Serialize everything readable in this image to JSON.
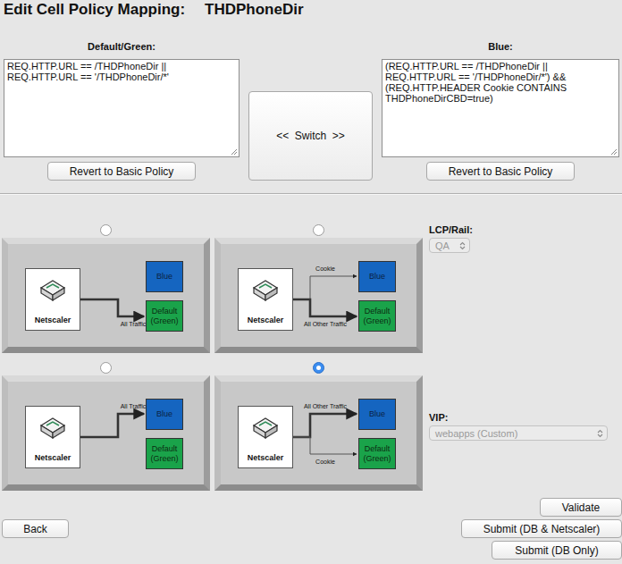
{
  "title": {
    "label": "Edit Cell Policy Mapping:",
    "name": "THDPhoneDir"
  },
  "policies": [
    {
      "label": "Default/Green:",
      "text": "REQ.HTTP.URL == /THDPhoneDir ||\nREQ.HTTP.URL == '/THDPhoneDir/*'",
      "revert": "Revert to Basic Policy"
    },
    {
      "label": "Blue:",
      "text": "(REQ.HTTP.URL == /THDPhoneDir ||\nREQ.HTTP.URL == '/THDPhoneDir/*') &&\n(REQ.HTTP.HEADER Cookie CONTAINS\nTHDPhoneDirCBD=true)",
      "revert": "Revert to Basic Policy"
    }
  ],
  "switch_button": "<<  Switch  >>",
  "nodes": {
    "netscaler": "Netscaler",
    "blue": "Blue",
    "green": "Default (Green)"
  },
  "modes": [
    {
      "selected": false,
      "routes": [
        {
          "label": "All Traffic",
          "target": "green",
          "weight": "thick"
        }
      ]
    },
    {
      "selected": false,
      "routes": [
        {
          "label": "Cookie",
          "target": "blue",
          "weight": "thin"
        },
        {
          "label": "All Other Traffic",
          "target": "green",
          "weight": "thick"
        }
      ]
    },
    {
      "selected": false,
      "routes": [
        {
          "label": "All Traffic",
          "target": "blue",
          "weight": "thick"
        }
      ]
    },
    {
      "selected": true,
      "routes": [
        {
          "label": "All Other Traffic",
          "target": "blue",
          "weight": "thick"
        },
        {
          "label": "Cookie",
          "target": "green",
          "weight": "thin"
        }
      ]
    }
  ],
  "lcp": {
    "label": "LCP/Rail:",
    "value": "QA",
    "disabled": true
  },
  "vip": {
    "label": "VIP:",
    "value": "webapps (Custom)",
    "disabled": true
  },
  "buttons": {
    "validate": "Validate",
    "back": "Back",
    "submit_all": "Submit (DB & Netscaler)",
    "submit_db": "Submit (DB Only)"
  }
}
